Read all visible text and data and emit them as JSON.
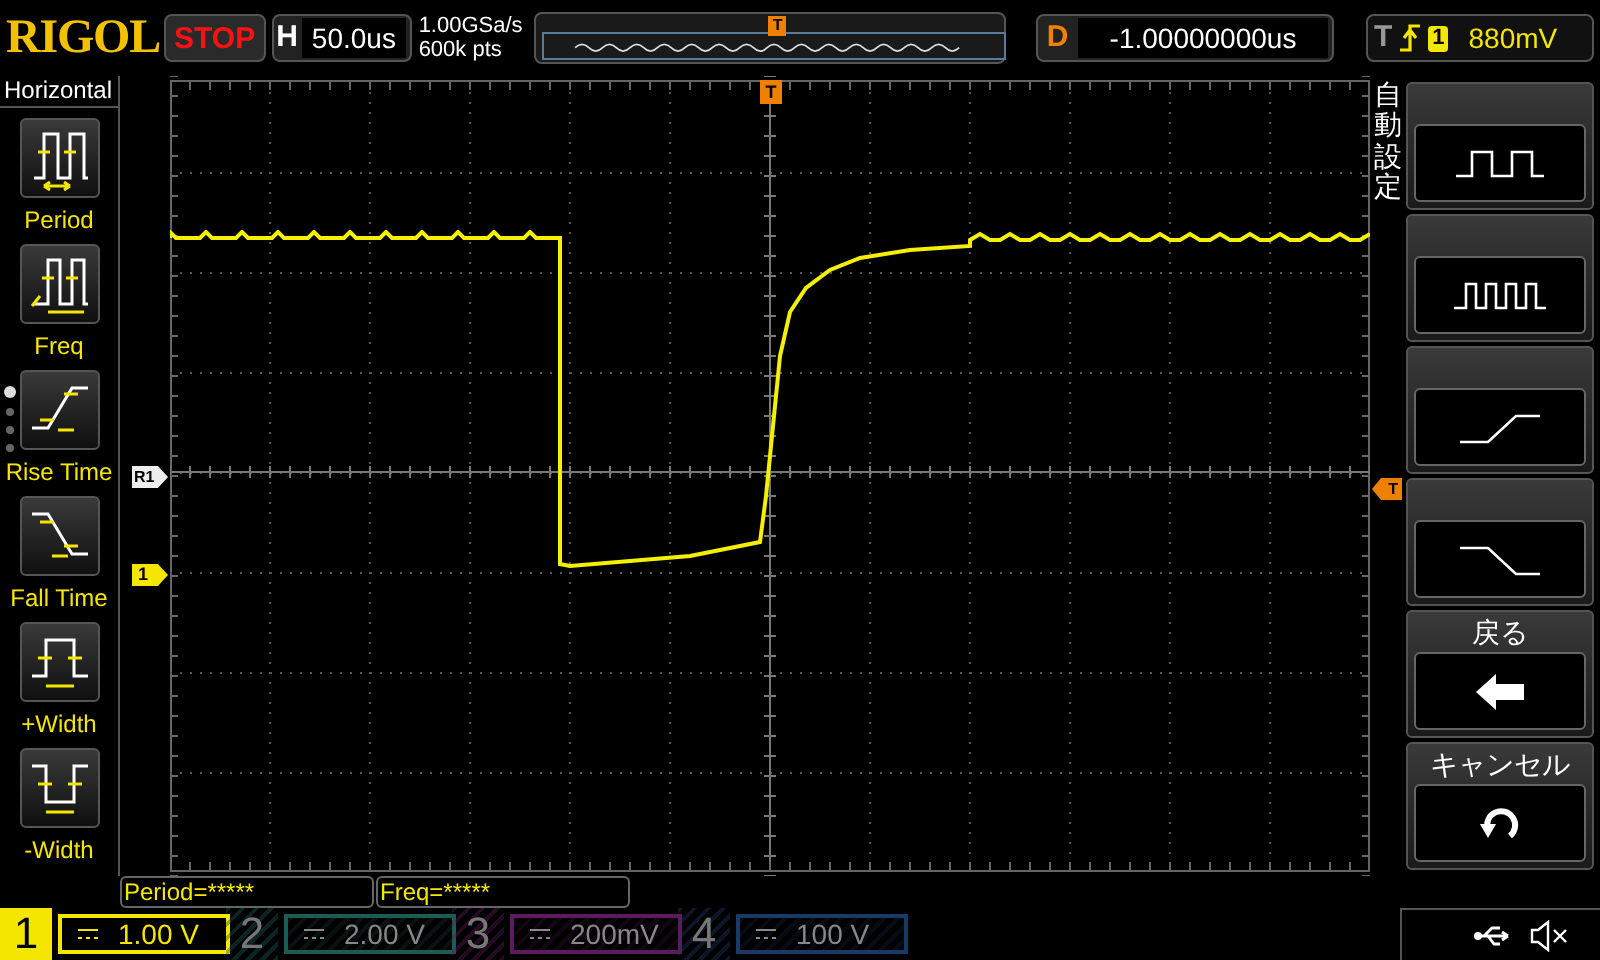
{
  "brand": "RIGOL",
  "run_state": {
    "label": "STOP"
  },
  "horizontal": {
    "label": "H",
    "timebase": "50.0us"
  },
  "acquisition": {
    "sample_rate": "1.00GSa/s",
    "memory_depth": "600k pts"
  },
  "overview": {
    "marker": "T"
  },
  "delay": {
    "label": "D",
    "value": "-1.00000000us"
  },
  "trigger": {
    "label": "T",
    "source": "1",
    "threshold": "880mV"
  },
  "sidebar": {
    "title": "Horizontal",
    "items": [
      {
        "kind": "period",
        "label": "Period"
      },
      {
        "kind": "freq",
        "label": "Freq"
      },
      {
        "kind": "rise",
        "label": "Rise Time"
      },
      {
        "kind": "fall",
        "label": "Fall Time"
      },
      {
        "kind": "pwidth",
        "label": "+Width"
      },
      {
        "kind": "nwidth",
        "label": "-Width"
      }
    ],
    "pages": [
      {
        "selected": true
      },
      {
        "selected": false
      },
      {
        "selected": false
      },
      {
        "selected": false
      }
    ]
  },
  "markers": {
    "reference": "R1",
    "channel": "1",
    "trigger_position": "T",
    "trigger_level": "T"
  },
  "autoset": {
    "title": "自動設定",
    "buttons": [
      {
        "kind": "square"
      },
      {
        "kind": "burst"
      },
      {
        "kind": "rise"
      },
      {
        "kind": "fall"
      },
      {
        "kind": "back",
        "title": "戻る"
      },
      {
        "kind": "cancel",
        "title": "キャンセル"
      }
    ]
  },
  "measurements": [
    {
      "text": "Period=*****"
    },
    {
      "text": "Freq=*****"
    }
  ],
  "channels": [
    {
      "number": "1",
      "scale": "1.00 V",
      "selected": true,
      "color": "#f5e600"
    },
    {
      "number": "2",
      "scale": "2.00 V",
      "selected": false,
      "color": "#1d5c55"
    },
    {
      "number": "3",
      "scale": "200mV",
      "selected": false,
      "color": "#5e1a5e"
    },
    {
      "number": "4",
      "scale": "100 V",
      "selected": false,
      "color": "#1a3a66"
    }
  ]
}
